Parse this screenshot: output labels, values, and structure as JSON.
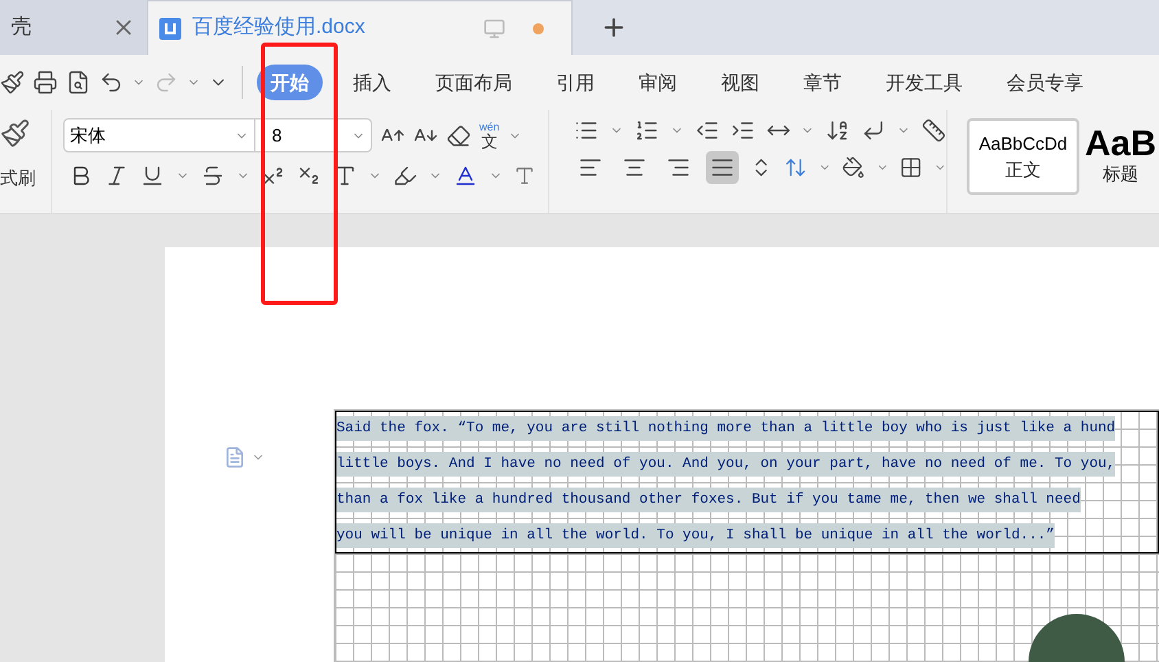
{
  "tabs": [
    {
      "title": "壳",
      "selected": false,
      "unsaved": false
    },
    {
      "title": "百度经验使用.docx",
      "selected": true,
      "unsaved": true
    }
  ],
  "ribbon_tabs": [
    {
      "label": "开始",
      "selected": true
    },
    {
      "label": "插入",
      "selected": false
    },
    {
      "label": "页面布局",
      "selected": false
    },
    {
      "label": "引用",
      "selected": false
    },
    {
      "label": "审阅",
      "selected": false
    },
    {
      "label": "视图",
      "selected": false
    },
    {
      "label": "章节",
      "selected": false
    },
    {
      "label": "开发工具",
      "selected": false
    },
    {
      "label": "会员专享",
      "selected": false
    }
  ],
  "format_painter": {
    "label": "式刷"
  },
  "font": {
    "name": "宋体",
    "size": "8"
  },
  "phonetic_button": {
    "pinyin": "wén",
    "character": "文"
  },
  "alignment": [
    {
      "kind": "left",
      "selected": false
    },
    {
      "kind": "center",
      "selected": false
    },
    {
      "kind": "right",
      "selected": false
    },
    {
      "kind": "justify",
      "selected": true
    }
  ],
  "styles": [
    {
      "sample": "AaBbCcDd",
      "name": "正文",
      "selected": true
    },
    {
      "sample": "AaB",
      "name": "标题",
      "selected": false
    }
  ],
  "document": {
    "lines": [
      "Said the fox. “To me, you are still nothing more than a little boy who is just like a hund",
      "little boys. And I have no need of you. And you, on your part, have no need of me. To you,",
      "than a fox like a hundred thousand other foxes. But if you tame me, then we shall need",
      "you will be unique in all the world. To you, I shall be unique in all the world...”"
    ]
  }
}
